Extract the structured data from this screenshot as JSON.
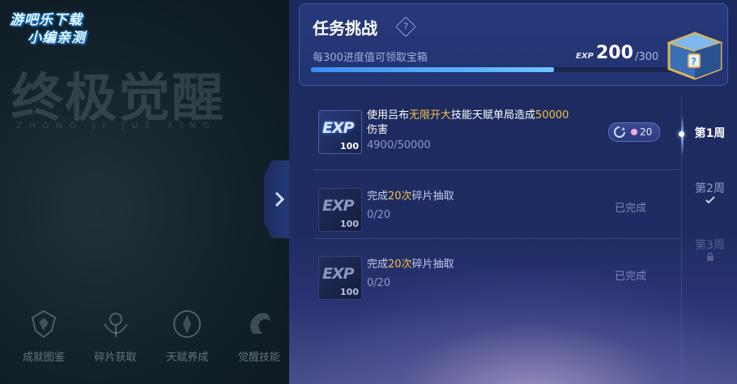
{
  "watermark": {
    "line1": "游吧乐下载",
    "line2": "小编亲测"
  },
  "background": {
    "title": "终极觉醒",
    "pinyin": "ZHONG  JI  JUE  XING"
  },
  "bottom_nav": [
    {
      "label": "成就图鉴",
      "icon": "achievement-icon"
    },
    {
      "label": "碎片获取",
      "icon": "fragment-icon"
    },
    {
      "label": "天赋养成",
      "icon": "talent-icon"
    },
    {
      "label": "觉醒技能",
      "icon": "awakening-icon"
    }
  ],
  "header": {
    "title": "任务挑战",
    "help": "?",
    "subtitle": "每300进度值可领取宝箱",
    "exp_badge": "EXP",
    "exp_current": "200",
    "exp_max": "/300",
    "progress": 0.6667
  },
  "tasks": [
    {
      "exp_label": "EXP",
      "exp_amount": "100",
      "title_parts": [
        "使用吕布",
        "无限开大",
        "技能天赋单局造成",
        "50000",
        "伤害"
      ],
      "progress": "4900/50000",
      "reward_count": "20",
      "status": ""
    },
    {
      "exp_label": "EXP",
      "exp_amount": "100",
      "title_parts": [
        "完成",
        "20次",
        "碎片抽取"
      ],
      "progress": "0/20",
      "status": "已完成"
    },
    {
      "exp_label": "EXP",
      "exp_amount": "100",
      "title_parts": [
        "完成",
        "20次",
        "碎片抽取"
      ],
      "progress": "0/20",
      "status": "已完成"
    }
  ],
  "weeks": [
    {
      "label": "第1周",
      "state": "active"
    },
    {
      "label": "第2周",
      "state": "completed"
    },
    {
      "label": "第3周",
      "state": "locked"
    }
  ],
  "colors": {
    "highlight": "#f2c14e",
    "progress": "#4aa3f5",
    "panel": "#1e2c63"
  }
}
